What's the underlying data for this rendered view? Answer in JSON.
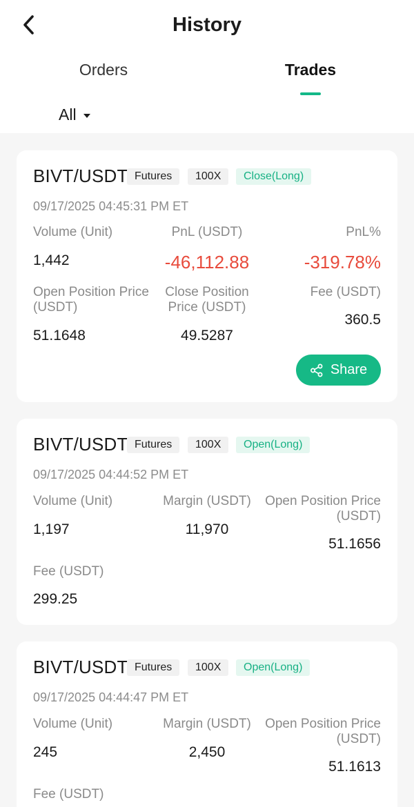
{
  "header": {
    "title": "History",
    "tabs": [
      {
        "label": "Orders",
        "active": false
      },
      {
        "label": "Trades",
        "active": true
      }
    ],
    "filter_label": "All"
  },
  "colors": {
    "accent": "#13b888",
    "loss": "#e84b3c",
    "tag_green_bg": "#e5f7f0"
  },
  "trades": [
    {
      "pair": "BIVT/USDT",
      "type": "Futures",
      "leverage": "100X",
      "direction": "Close(Long)",
      "time": "09/17/2025 04:45:31 PM ET",
      "volume_label": "Volume (Unit)",
      "volume": "1,442",
      "pnl_label": "PnL (USDT)",
      "pnl": "-46,112.88",
      "pnl_pct_label": "PnL%",
      "pnl_pct": "-319.78%",
      "open_price_label": "Open Position Price (USDT)",
      "open_price": "51.1648",
      "close_price_label": "Close Position Price (USDT)",
      "close_price": "49.5287",
      "fee_label": "Fee (USDT)",
      "fee": "360.5",
      "share_label": "Share"
    },
    {
      "pair": "BIVT/USDT",
      "type": "Futures",
      "leverage": "100X",
      "direction": "Open(Long)",
      "time": "09/17/2025 04:44:52 PM ET",
      "volume_label": "Volume (Unit)",
      "volume": "1,197",
      "margin_label": "Margin (USDT)",
      "margin": "11,970",
      "open_price_label": "Open Position Price (USDT)",
      "open_price": "51.1656",
      "fee_label": "Fee (USDT)",
      "fee": "299.25"
    },
    {
      "pair": "BIVT/USDT",
      "type": "Futures",
      "leverage": "100X",
      "direction": "Open(Long)",
      "time": "09/17/2025 04:44:47 PM ET",
      "volume_label": "Volume (Unit)",
      "volume": "245",
      "margin_label": "Margin (USDT)",
      "margin": "2,450",
      "open_price_label": "Open Position Price (USDT)",
      "open_price": "51.1613",
      "fee_label": "Fee (USDT)"
    }
  ]
}
